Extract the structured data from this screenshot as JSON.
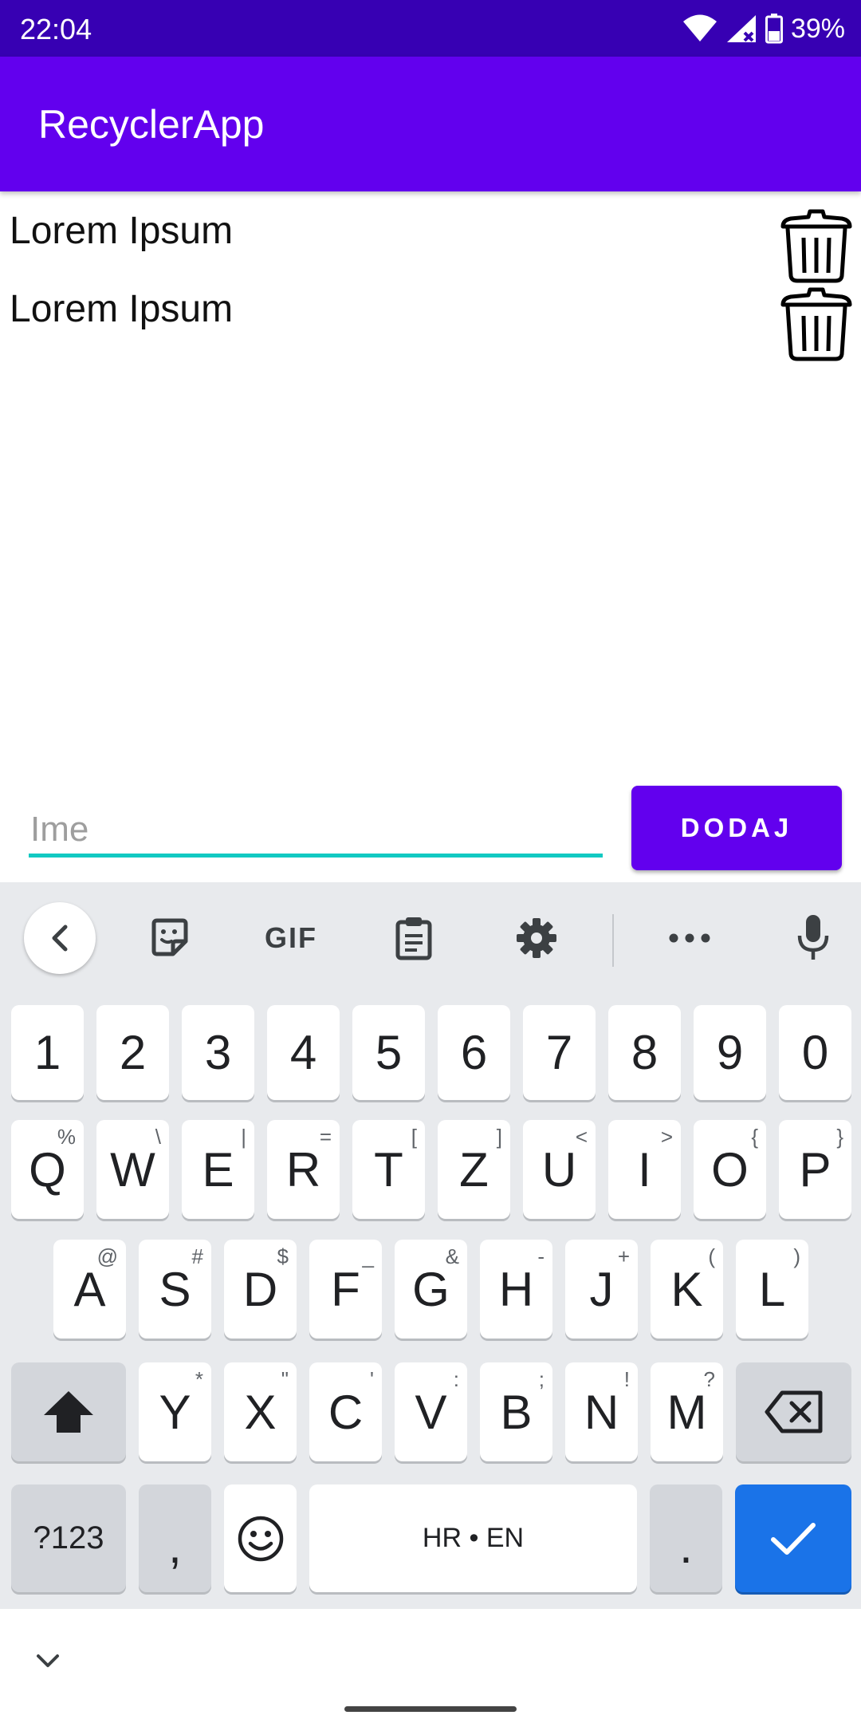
{
  "status_bar": {
    "time": "22:04",
    "battery": "39%"
  },
  "app_bar": {
    "title": "RecyclerApp"
  },
  "list": {
    "items": [
      {
        "label": "Lorem Ipsum",
        "icon": "trash-icon"
      },
      {
        "label": "Lorem Ipsum",
        "icon": "trash-icon"
      }
    ]
  },
  "form": {
    "name_placeholder": "Ime",
    "name_value": "",
    "add_label": "DODAJ",
    "accent_color": "#6200EE",
    "underline_color": "#12C9C2"
  },
  "keyboard": {
    "toolbar": {
      "gif_label": "GIF",
      "icons": [
        "back-icon",
        "sticker-icon",
        "gif-icon",
        "clipboard-icon",
        "settings-icon",
        "more-icon",
        "mic-icon"
      ]
    },
    "number_row": [
      "1",
      "2",
      "3",
      "4",
      "5",
      "6",
      "7",
      "8",
      "9",
      "0"
    ],
    "row1": [
      {
        "k": "Q",
        "h": "%"
      },
      {
        "k": "W",
        "h": "\\"
      },
      {
        "k": "E",
        "h": "|"
      },
      {
        "k": "R",
        "h": "="
      },
      {
        "k": "T",
        "h": "["
      },
      {
        "k": "Z",
        "h": "]"
      },
      {
        "k": "U",
        "h": "<"
      },
      {
        "k": "I",
        "h": ">"
      },
      {
        "k": "O",
        "h": "{"
      },
      {
        "k": "P",
        "h": "}"
      }
    ],
    "row2": [
      {
        "k": "A",
        "h": "@"
      },
      {
        "k": "S",
        "h": "#"
      },
      {
        "k": "D",
        "h": "$"
      },
      {
        "k": "F",
        "h": "_"
      },
      {
        "k": "G",
        "h": "&"
      },
      {
        "k": "H",
        "h": "-"
      },
      {
        "k": "J",
        "h": "+"
      },
      {
        "k": "K",
        "h": "("
      },
      {
        "k": "L",
        "h": ")"
      }
    ],
    "row3": [
      {
        "k": "Y",
        "h": "*"
      },
      {
        "k": "X",
        "h": "\""
      },
      {
        "k": "C",
        "h": "'"
      },
      {
        "k": "V",
        "h": ":"
      },
      {
        "k": "B",
        "h": ";"
      },
      {
        "k": "N",
        "h": "!"
      },
      {
        "k": "M",
        "h": "?"
      }
    ],
    "bottom": {
      "symbols": "?123",
      "comma": ",",
      "space": "HR • EN",
      "period": "."
    }
  }
}
